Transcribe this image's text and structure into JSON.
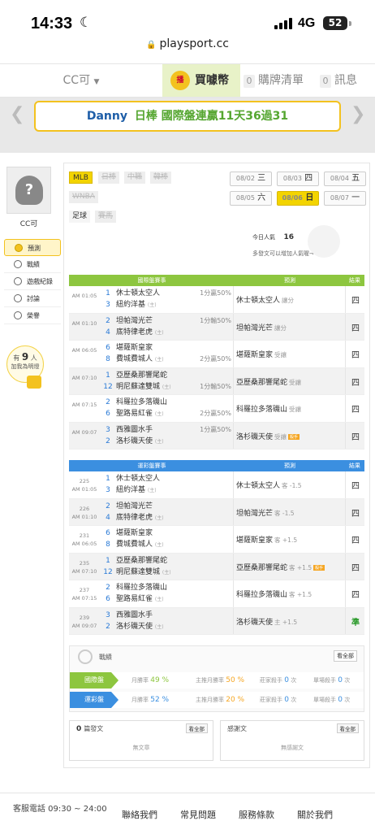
{
  "status": {
    "time": "14:33",
    "network": "4G",
    "battery": "52"
  },
  "url": "playsport.cc",
  "nav": {
    "cc": "CC可",
    "coin_badge": "播",
    "coin": "買噱幣",
    "cart_count": "0",
    "cart": "購牌清單",
    "msg_count": "0",
    "msg": "訊息"
  },
  "banner": {
    "name": "Danny",
    "text": "日棒 國際盤連贏11天36過31"
  },
  "sidebar": {
    "user": "CC可",
    "items": [
      {
        "label": "預測"
      },
      {
        "label": "戰績"
      },
      {
        "label": "遊戲紀錄"
      },
      {
        "label": "討論"
      },
      {
        "label": "榮譽"
      }
    ],
    "bulb_pre": "有",
    "bulb_count": "9",
    "bulb_post": "人",
    "bulb_text": "加我為明燈"
  },
  "sports": [
    "MLB",
    "日棒",
    "中職",
    "韓棒",
    "WNBA",
    "足球",
    "賽馬"
  ],
  "dates": [
    {
      "d": "08/02",
      "w": "三"
    },
    {
      "d": "08/03",
      "w": "四"
    },
    {
      "d": "08/04",
      "w": "五"
    },
    {
      "d": "08/05",
      "w": "六"
    },
    {
      "d": "08/06",
      "w": "日"
    },
    {
      "d": "08/07",
      "w": "一"
    }
  ],
  "popularity": {
    "label": "今日人氣",
    "value": "16",
    "hint": "多發文可以增加人氣喔→"
  },
  "intl_table": {
    "headers": {
      "game": "國際盤賽事",
      "pick": "預測",
      "result": "結果"
    },
    "rows": [
      {
        "time": "AM 01:05",
        "n1": "1",
        "n2": "3",
        "t1": "休士頓太空人",
        "t2": "紐約洋基",
        "l1": "1分贏50%",
        "l2": "",
        "pick": "休士頓太空人",
        "pnote": "讓分",
        "res": "四"
      },
      {
        "time": "AM 01:10",
        "n1": "2",
        "n2": "4",
        "t1": "坦帕灣光芒",
        "t2": "底特律老虎",
        "l1": "1分輸50%",
        "l2": "",
        "pick": "坦帕灣光芒",
        "pnote": "讓分",
        "res": "四"
      },
      {
        "time": "AM 06:05",
        "n1": "6",
        "n2": "8",
        "t1": "堪薩斯皇家",
        "t2": "費城費城人",
        "l1": "",
        "l2": "2分贏50%",
        "pick": "堪薩斯皇家",
        "pnote": "受讓",
        "res": "四"
      },
      {
        "time": "AM 07:10",
        "n1": "1",
        "n2": "12",
        "t1": "亞歷桑那響尾蛇",
        "t2": "明尼蘇達雙城",
        "l1": "",
        "l2": "1分輸50%",
        "pick": "亞歷桑那響尾蛇",
        "pnote": "受讓",
        "res": "四"
      },
      {
        "time": "AM 07:15",
        "n1": "2",
        "n2": "6",
        "t1": "科羅拉多落磯山",
        "t2": "聖路易紅雀",
        "l1": "",
        "l2": "2分贏50%",
        "pick": "科羅拉多落磯山",
        "pnote": "受讓",
        "res": "四"
      },
      {
        "time": "AM 09:07",
        "n1": "3",
        "n2": "2",
        "t1": "西雅圖水手",
        "t2": "洛杉磯天使",
        "l1": "1分贏50%",
        "l2": "",
        "pick": "洛杉磯天使",
        "pnote": "受讓",
        "tag": "殺手",
        "res": "四"
      }
    ]
  },
  "lottery_table": {
    "headers": {
      "game": "運彩盤賽事",
      "pick": "預測",
      "result": "結果"
    },
    "rows": [
      {
        "no": "225",
        "time": "AM 01:05",
        "n1": "1",
        "n2": "3",
        "t1": "休士頓太空人",
        "t2": "紐約洋基",
        "pick": "休士頓太空人",
        "pnote": "客 -1.5",
        "res": "四"
      },
      {
        "no": "226",
        "time": "AM 01:10",
        "n1": "2",
        "n2": "4",
        "t1": "坦帕灣光芒",
        "t2": "底特律老虎",
        "pick": "坦帕灣光芒",
        "pnote": "客 -1.5",
        "res": "四"
      },
      {
        "no": "231",
        "time": "AM 06:05",
        "n1": "6",
        "n2": "8",
        "t1": "堪薩斯皇家",
        "t2": "費城費城人",
        "pick": "堪薩斯皇家",
        "pnote": "客 +1.5",
        "res": "四"
      },
      {
        "no": "235",
        "time": "AM 07:10",
        "n1": "1",
        "n2": "12",
        "t1": "亞歷桑那響尾蛇",
        "t2": "明尼蘇達雙城",
        "pick": "亞歷桑那響尾蛇",
        "pnote": "客 +1.5",
        "tag": "殺手",
        "res": "四"
      },
      {
        "no": "237",
        "time": "AM 07:15",
        "n1": "2",
        "n2": "6",
        "t1": "科羅拉多落磯山",
        "t2": "聖路易紅雀",
        "pick": "科羅拉多落磯山",
        "pnote": "客 +1.5",
        "res": "四"
      },
      {
        "no": "239",
        "time": "AM 09:07",
        "n1": "3",
        "n2": "2",
        "t1": "西雅圖水手",
        "t2": "洛杉磯天使",
        "pick": "洛杉磯天使",
        "pnote": "主 +1.5",
        "res": "準"
      }
    ]
  },
  "stats": {
    "title": "戰績",
    "all": "看全部",
    "rows": [
      {
        "tag": "國際盤",
        "month": "月勝率",
        "month_v": "49 %",
        "main": "主推月勝率",
        "main_v": "50 %",
        "dealer": "莊家殺手",
        "dealer_v": "0",
        "dealer_u": "次",
        "single": "單場殺手",
        "single_v": "0",
        "single_u": "次"
      },
      {
        "tag": "運彩盤",
        "month": "月勝率",
        "month_v": "52 %",
        "main": "主推月勝率",
        "main_v": "20 %",
        "dealer": "莊家殺手",
        "dealer_v": "0",
        "dealer_u": "次",
        "single": "單場殺手",
        "single_v": "0",
        "single_u": "次"
      }
    ]
  },
  "posts": {
    "count": "0",
    "label": "篇發文",
    "all": "看全部",
    "empty": "無文章"
  },
  "thanks": {
    "label": "感謝文",
    "all": "看全部",
    "empty": "無感謝文"
  },
  "footer": {
    "service": "客服電話 09:30 ~ 24:00",
    "links": [
      "聯絡我們",
      "常見問題",
      "服務條款",
      "關於我們"
    ]
  },
  "colors": {
    "green": "#8dc63f",
    "blue": "#3b8fe0",
    "yellow": "#f3d400",
    "banner_green": "#55a630",
    "banner_blue": "#1e5ea8"
  }
}
